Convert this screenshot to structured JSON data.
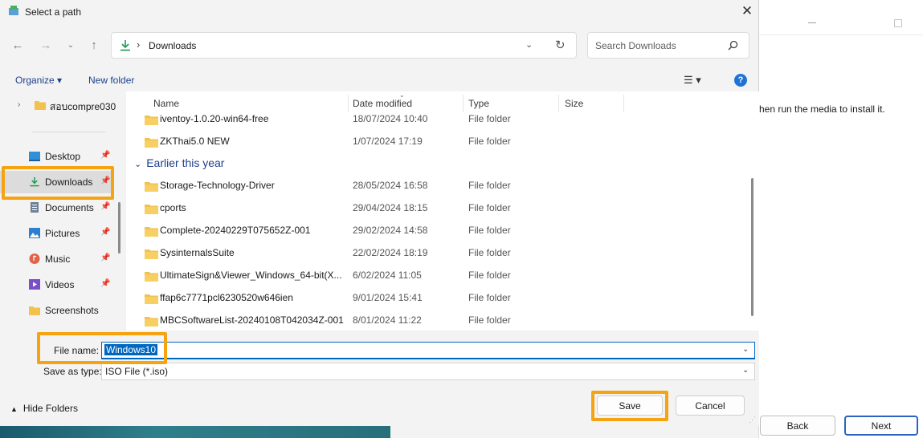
{
  "dialog": {
    "title": "Select a path",
    "address": {
      "separator": "›",
      "location": "Downloads"
    },
    "search": {
      "placeholder": "Search Downloads"
    },
    "toolbar": {
      "organize": "Organize ▾",
      "new_folder": "New folder",
      "view": "☰ ▾",
      "help": "?"
    },
    "sidebar": {
      "top_item": "สอบcompre030",
      "items": [
        {
          "label": "Desktop",
          "icon": "desktop-icon"
        },
        {
          "label": "Downloads",
          "icon": "downloads-icon",
          "selected": true
        },
        {
          "label": "Documents",
          "icon": "documents-icon"
        },
        {
          "label": "Pictures",
          "icon": "pictures-icon"
        },
        {
          "label": "Music",
          "icon": "music-icon"
        },
        {
          "label": "Videos",
          "icon": "videos-icon"
        },
        {
          "label": "Screenshots",
          "icon": "folder-icon"
        }
      ]
    },
    "columns": {
      "name": "Name",
      "date": "Date modified",
      "type": "Type",
      "size": "Size"
    },
    "files_recent": [
      {
        "name": "iventoy-1.0.20-win64-free",
        "date": "18/07/2024 10:40",
        "type": "File folder"
      },
      {
        "name": "ZKThai5.0 NEW",
        "date": "1/07/2024 17:19",
        "type": "File folder"
      }
    ],
    "group_label": "Earlier this year",
    "files_earlier": [
      {
        "name": "Storage-Technology-Driver",
        "date": "28/05/2024 16:58",
        "type": "File folder"
      },
      {
        "name": "cports",
        "date": "29/04/2024 18:15",
        "type": "File folder"
      },
      {
        "name": "Complete-20240229T075652Z-001",
        "date": "29/02/2024 14:58",
        "type": "File folder"
      },
      {
        "name": "SysinternalsSuite",
        "date": "22/02/2024 18:19",
        "type": "File folder"
      },
      {
        "name": "UltimateSign&Viewer_Windows_64-bit(X...",
        "date": "6/02/2024 11:05",
        "type": "File folder"
      },
      {
        "name": "ffap6c7771pcl6230520w646ien",
        "date": "9/01/2024 15:41",
        "type": "File folder"
      },
      {
        "name": "MBCSoftwareList-20240108T042034Z-001",
        "date": "8/01/2024 11:22",
        "type": "File folder"
      }
    ],
    "file_name_label": "File name:",
    "file_name_value": "Windows10",
    "save_type_label": "Save as type:",
    "save_type_value": "ISO File (*.iso)",
    "hide_folders": "Hide Folders",
    "save": "Save",
    "cancel": "Cancel"
  },
  "background_window": {
    "message": "hen run the media to install it.",
    "back": "Back",
    "next": "Next"
  },
  "colors": {
    "highlight": "#f5a313",
    "accent": "#0067c0",
    "link": "#1b3f8c"
  }
}
